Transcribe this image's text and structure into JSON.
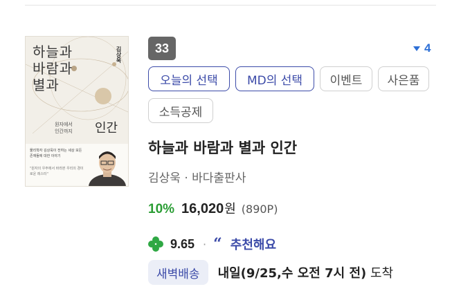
{
  "book": {
    "cover": {
      "title_line1": "하늘과",
      "title_line2": "바람과",
      "title_line3": "별과",
      "author": "김상욱",
      "subtitle_line1": "원자에서",
      "subtitle_line2": "인간까지",
      "big_word": "인간",
      "desc": "물리학자 김상욱이 전하는 세상 모든 존재들에 대한 이야기",
      "quote": "\"원자의 우주에서 바라본 우리의 경이로운 레스터\""
    },
    "rank": "33",
    "rank_change": "4",
    "tags": [
      "오늘의 선택",
      "MD의 선택",
      "이벤트",
      "사은품",
      "소득공제"
    ],
    "title": "하늘과 바람과 별과 인간",
    "author_publisher": "김상욱 · 바다출판사",
    "price": {
      "discount": "10%",
      "amount": "16,020",
      "currency": "원",
      "points": "(890P)"
    },
    "rating": {
      "score": "9.65",
      "separator": "·",
      "review_label": "추천해요"
    },
    "delivery": {
      "badge": "새벽배송",
      "when": "내일(9/25,수 오전 7시 전)",
      "suffix": " 도착"
    },
    "colors": {
      "accent_blue": "#3b4aa8",
      "discount_green": "#2a9d34",
      "rank_badge": "#666666",
      "rank_change_blue": "#2d6fd6"
    }
  }
}
